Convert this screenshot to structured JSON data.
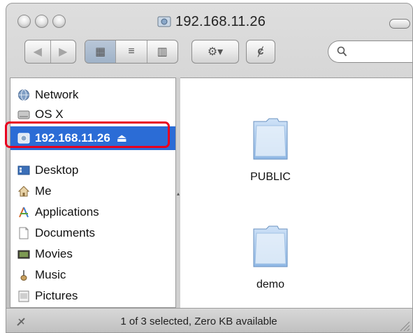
{
  "window": {
    "title": "192.168.11.26"
  },
  "toolbar": {
    "back_label": "◀",
    "forward_label": "▶",
    "view_icon_label": "▦",
    "view_list_label": "≡",
    "view_column_label": "▥",
    "action_label": "⚙▾",
    "path_label": "ȼ",
    "search_placeholder": ""
  },
  "sidebar": {
    "items": [
      {
        "label": "Network",
        "icon": "network-icon"
      },
      {
        "label": "OS X",
        "icon": "harddisk-icon"
      },
      {
        "label": "192.168.11.26",
        "icon": "server-icon",
        "selected": true,
        "eject": "⏏"
      },
      {
        "label": "Desktop",
        "icon": "desktop-icon"
      },
      {
        "label": "Me",
        "icon": "home-icon"
      },
      {
        "label": "Applications",
        "icon": "applications-icon"
      },
      {
        "label": "Documents",
        "icon": "documents-icon"
      },
      {
        "label": "Movies",
        "icon": "movies-icon"
      },
      {
        "label": "Music",
        "icon": "music-icon"
      },
      {
        "label": "Pictures",
        "icon": "pictures-icon"
      }
    ]
  },
  "content": {
    "folders": [
      {
        "label": "PUBLIC"
      },
      {
        "label": "demo"
      }
    ]
  },
  "status": {
    "text": "1 of 3 selected, Zero KB available"
  },
  "colors": {
    "selection": "#2b6cd6",
    "highlight": "#e8001f",
    "folder": "#8fb8e6"
  }
}
